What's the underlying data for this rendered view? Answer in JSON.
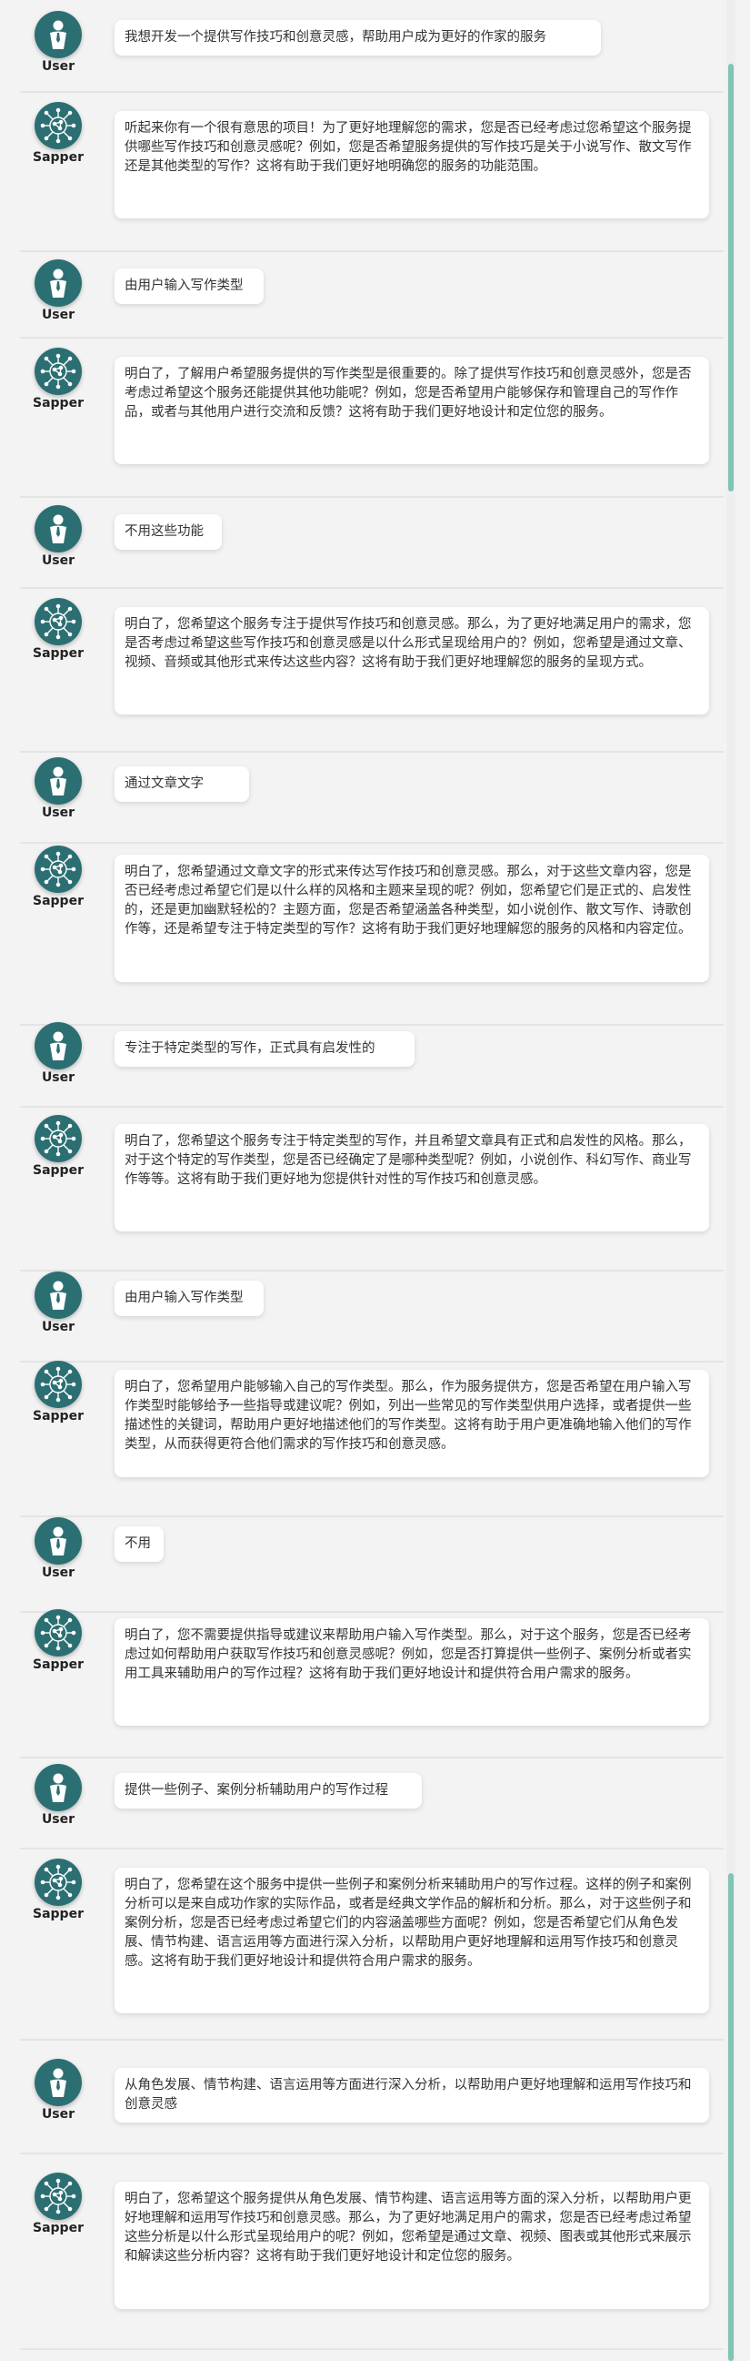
{
  "labels": {
    "user": "User",
    "bot": "Sapper"
  },
  "colors": {
    "avatar_bg": "#2b6f73",
    "scrollbar": "#7fc4b5"
  },
  "icons": {
    "user": "person-icon",
    "bot": "network-brain-icon"
  },
  "messages": [
    {
      "role": "user",
      "text": "我想开发一个提供写作技巧和创意灵感，帮助用户成为更好的作家的服务"
    },
    {
      "role": "bot",
      "text": "听起来你有一个很有意思的项目！为了更好地理解您的需求，您是否已经考虑过您希望这个服务提供哪些写作技巧和创意灵感呢？例如，您是否希望服务提供的写作技巧是关于小说写作、散文写作还是其他类型的写作？这将有助于我们更好地明确您的服务的功能范围。"
    },
    {
      "role": "user",
      "text": "由用户输入写作类型"
    },
    {
      "role": "bot",
      "text": "明白了，了解用户希望服务提供的写作类型是很重要的。除了提供写作技巧和创意灵感外，您是否考虑过希望这个服务还能提供其他功能呢？例如，您是否希望用户能够保存和管理自己的写作作品，或者与其他用户进行交流和反馈？这将有助于我们更好地设计和定位您的服务。"
    },
    {
      "role": "user",
      "text": "不用这些功能"
    },
    {
      "role": "bot",
      "text": "明白了，您希望这个服务专注于提供写作技巧和创意灵感。那么，为了更好地满足用户的需求，您是否考虑过希望这些写作技巧和创意灵感是以什么形式呈现给用户的？例如，您希望是通过文章、视频、音频或其他形式来传达这些内容？这将有助于我们更好地理解您的服务的呈现方式。"
    },
    {
      "role": "user",
      "text": "通过文章文字"
    },
    {
      "role": "bot",
      "text": "明白了，您希望通过文章文字的形式来传达写作技巧和创意灵感。那么，对于这些文章内容，您是否已经考虑过希望它们是以什么样的风格和主题来呈现的呢？例如，您希望它们是正式的、启发性的，还是更加幽默轻松的？主题方面，您是否希望涵盖各种类型，如小说创作、散文写作、诗歌创作等，还是希望专注于特定类型的写作？这将有助于我们更好地理解您的服务的风格和内容定位。"
    },
    {
      "role": "user",
      "text": "专注于特定类型的写作，正式具有启发性的"
    },
    {
      "role": "bot",
      "text": "明白了，您希望这个服务专注于特定类型的写作，并且希望文章具有正式和启发性的风格。那么，对于这个特定的写作类型，您是否已经确定了是哪种类型呢？例如，小说创作、科幻写作、商业写作等等。这将有助于我们更好地为您提供针对性的写作技巧和创意灵感。"
    },
    {
      "role": "user",
      "text": "由用户输入写作类型"
    },
    {
      "role": "bot",
      "text": "明白了，您希望用户能够输入自己的写作类型。那么，作为服务提供方，您是否希望在用户输入写作类型时能够给予一些指导或建议呢？例如，列出一些常见的写作类型供用户选择，或者提供一些描述性的关键词，帮助用户更好地描述他们的写作类型。这将有助于用户更准确地输入他们的写作类型，从而获得更符合他们需求的写作技巧和创意灵感。"
    },
    {
      "role": "user",
      "text": "不用"
    },
    {
      "role": "bot",
      "text": "明白了，您不需要提供指导或建议来帮助用户输入写作类型。那么，对于这个服务，您是否已经考虑过如何帮助用户获取写作技巧和创意灵感呢？例如，您是否打算提供一些例子、案例分析或者实用工具来辅助用户的写作过程？这将有助于我们更好地设计和提供符合用户需求的服务。"
    },
    {
      "role": "user",
      "text": "提供一些例子、案例分析辅助用户的写作过程"
    },
    {
      "role": "bot",
      "text": "明白了，您希望在这个服务中提供一些例子和案例分析来辅助用户的写作过程。这样的例子和案例分析可以是来自成功作家的实际作品，或者是经典文学作品的解析和分析。那么，对于这些例子和案例分析，您是否已经考虑过希望它们的内容涵盖哪些方面呢？例如，您是否希望它们从角色发展、情节构建、语言运用等方面进行深入分析，以帮助用户更好地理解和运用写作技巧和创意灵感。这将有助于我们更好地设计和提供符合用户需求的服务。"
    },
    {
      "role": "user",
      "text": "从角色发展、情节构建、语言运用等方面进行深入分析，以帮助用户更好地理解和运用写作技巧和创意灵感"
    },
    {
      "role": "bot",
      "text": "明白了，您希望这个服务提供从角色发展、情节构建、语言运用等方面的深入分析，以帮助用户更好地理解和运用写作技巧和创意灵感。那么，为了更好地满足用户的需求，您是否已经考虑过希望这些分析是以什么形式呈现给用户的呢？例如，您希望是通过文章、视频、图表或其他形式来展示和解读这些分析内容？这将有助于我们更好地设计和定位您的服务。"
    }
  ]
}
